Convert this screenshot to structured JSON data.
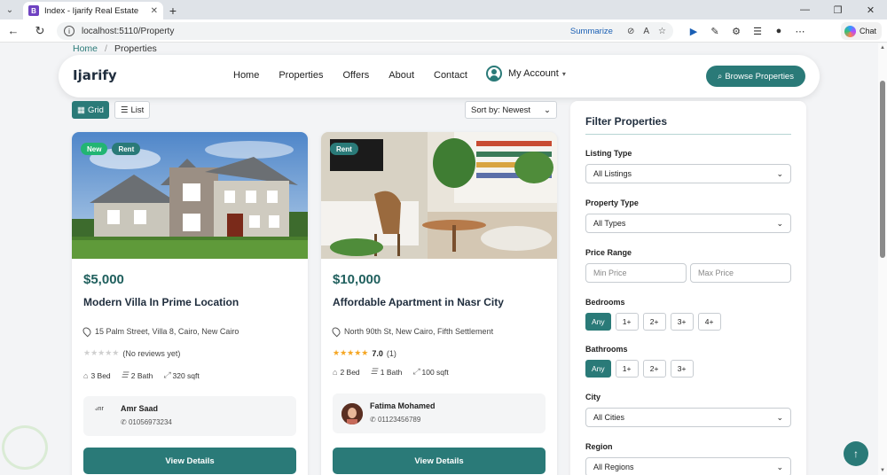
{
  "browser": {
    "tab_title": "Index - Ijarify Real Estate",
    "tab_favicon": "B",
    "url": "localhost:5110/Property",
    "summarize": "Summarize",
    "chat": "Chat"
  },
  "breadcrumb": {
    "home": "Home",
    "current": "Properties"
  },
  "navbar": {
    "brand": "Ijarify",
    "links": [
      "Home",
      "Properties",
      "Offers",
      "About",
      "Contact"
    ],
    "account": "My Account",
    "browse": "Browse Properties"
  },
  "toolbar": {
    "grid": "Grid",
    "list": "List",
    "sort": "Sort by: Newest"
  },
  "properties": [
    {
      "badges": [
        "New",
        "Rent"
      ],
      "price": "$5,000",
      "title": "Modern Villa In Prime Location",
      "address": "15 Palm Street, Villa 8, Cairo, New Cairo",
      "rating_text": "(No reviews yet)",
      "rating_score": "",
      "beds": "3 Bed",
      "baths": "2 Bath",
      "area": "320 sqft",
      "agent_name": "Amr Saad",
      "agent_avatar_alt": "Amr",
      "agent_phone": "01056973234",
      "button": "View Details"
    },
    {
      "badges": [
        "Rent"
      ],
      "price": "$10,000",
      "title": "Affordable Apartment in Nasr City",
      "address": "North 90th St, New Cairo, Fifth Settlement",
      "rating_text": "(1)",
      "rating_score": "7.0",
      "beds": "2 Bed",
      "baths": "1 Bath",
      "area": "100 sqft",
      "agent_name": "Fatima Mohamed",
      "agent_avatar_alt": "",
      "agent_phone": "01123456789",
      "button": "View Details"
    }
  ],
  "filters": {
    "title": "Filter Properties",
    "listing_type_label": "Listing Type",
    "listing_type_value": "All Listings",
    "property_type_label": "Property Type",
    "property_type_value": "All Types",
    "price_label": "Price Range",
    "min_placeholder": "Min Price",
    "max_placeholder": "Max Price",
    "bedrooms_label": "Bedrooms",
    "bedrooms_options": [
      "Any",
      "1+",
      "2+",
      "3+",
      "4+"
    ],
    "bathrooms_label": "Bathrooms",
    "bathrooms_options": [
      "Any",
      "1+",
      "2+",
      "3+"
    ],
    "city_label": "City",
    "city_value": "All Cities",
    "region_label": "Region",
    "region_value": "All Regions"
  },
  "colors": {
    "accent": "#2a7a78",
    "new_badge": "#22b573",
    "star": "#f5a623"
  }
}
